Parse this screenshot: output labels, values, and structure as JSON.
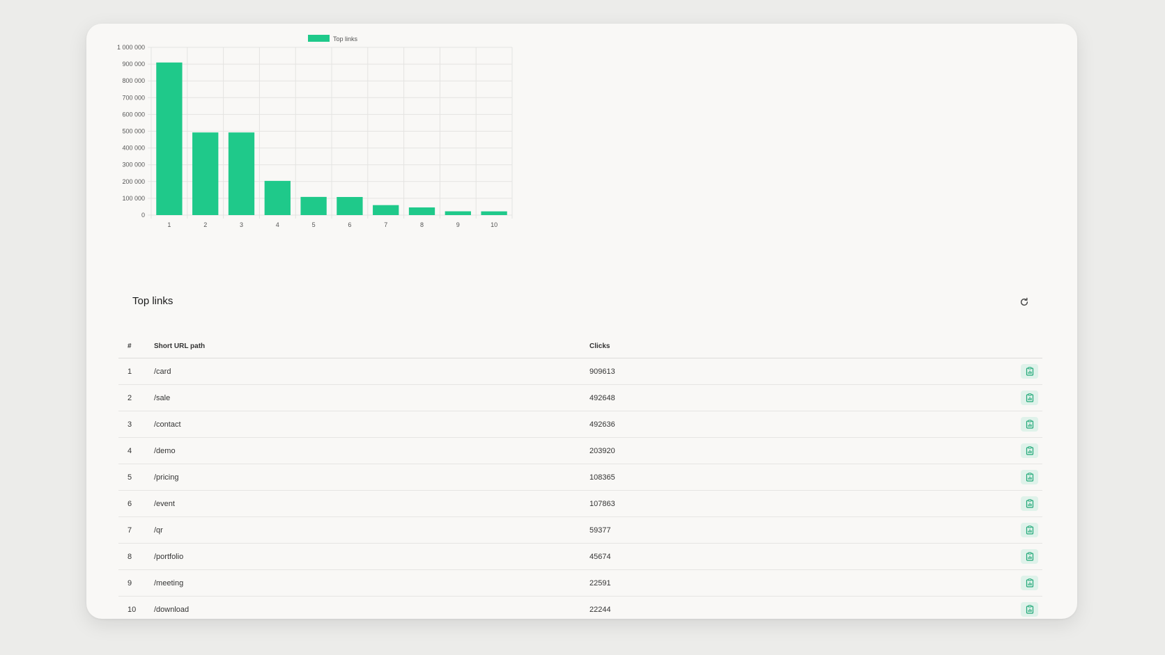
{
  "chart_data": {
    "type": "bar",
    "legend": {
      "label": "Top links",
      "position": "top",
      "color": "#1fc98a"
    },
    "categories": [
      "1",
      "2",
      "3",
      "4",
      "5",
      "6",
      "7",
      "8",
      "9",
      "10"
    ],
    "series": [
      {
        "name": "Top links",
        "values": [
          909613,
          492648,
          492636,
          203920,
          108365,
          107863,
          59377,
          45674,
          22591,
          22244
        ]
      }
    ],
    "ylim": [
      0,
      1000000
    ],
    "y_ticks": [
      "0",
      "100 000",
      "200 000",
      "300 000",
      "400 000",
      "500 000",
      "600 000",
      "700 000",
      "800 000",
      "900 000",
      "1 000 000"
    ],
    "grid": true,
    "bar_color": "#1fc98a"
  },
  "table": {
    "title": "Top links",
    "columns": {
      "num": "#",
      "path": "Short URL path",
      "clicks": "Clicks"
    },
    "rows": [
      {
        "num": "1",
        "path": "/card",
        "clicks": "909613"
      },
      {
        "num": "2",
        "path": "/sale",
        "clicks": "492648"
      },
      {
        "num": "3",
        "path": "/contact",
        "clicks": "492636"
      },
      {
        "num": "4",
        "path": "/demo",
        "clicks": "203920"
      },
      {
        "num": "5",
        "path": "/pricing",
        "clicks": "108365"
      },
      {
        "num": "6",
        "path": "/event",
        "clicks": "107863"
      },
      {
        "num": "7",
        "path": "/qr",
        "clicks": "59377"
      },
      {
        "num": "8",
        "path": "/portfolio",
        "clicks": "45674"
      },
      {
        "num": "9",
        "path": "/meeting",
        "clicks": "22591"
      },
      {
        "num": "10",
        "path": "/download",
        "clicks": "22244"
      }
    ],
    "row_action_icon": "bar-chart-icon",
    "refresh_icon": "refresh-icon"
  },
  "colors": {
    "accent": "#1fc98a",
    "icon": "#1ea776",
    "icon_bg": "#dff2ea"
  }
}
